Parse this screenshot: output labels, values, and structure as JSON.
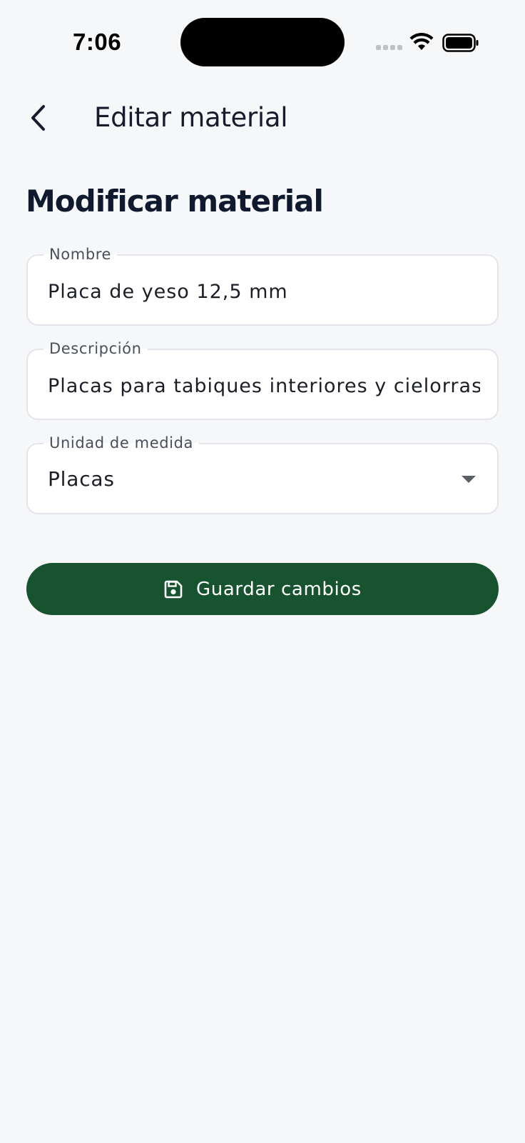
{
  "status_bar": {
    "time": "7:06"
  },
  "app_bar": {
    "back_icon": "chevron-left-icon",
    "title": "Editar material"
  },
  "page": {
    "heading": "Modificar material"
  },
  "form": {
    "nombre": {
      "label": "Nombre",
      "value": "Placa de yeso 12,5 mm"
    },
    "descripcion": {
      "label": "Descripción",
      "value": "Placas para tabiques interiores y cielorrasos"
    },
    "unidad": {
      "label": "Unidad de medida",
      "selected": "Placas",
      "icon": "dropdown-arrow-icon"
    }
  },
  "actions": {
    "save_label": "Guardar cambios",
    "save_icon": "floppy-disk-icon"
  },
  "colors": {
    "background": "#f6f7f9",
    "primary": "#17532f",
    "field_border": "#e3e5ea",
    "text": "#141b2d"
  }
}
